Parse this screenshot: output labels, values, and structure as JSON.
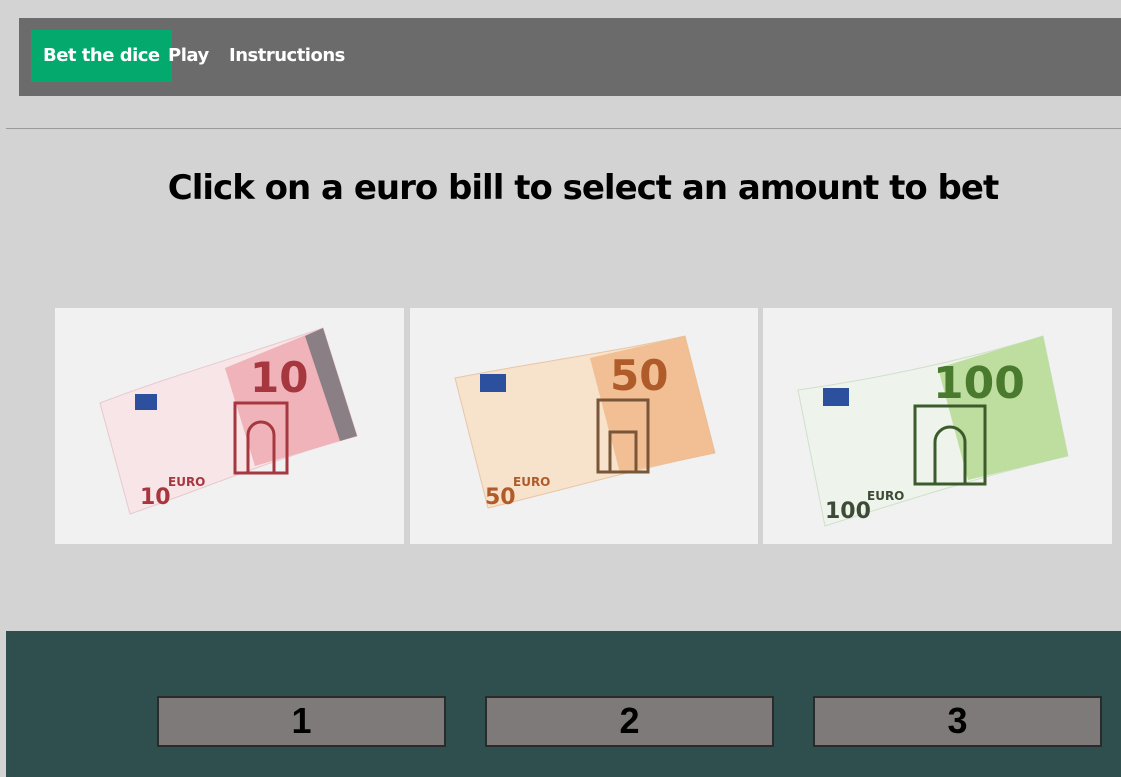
{
  "nav": {
    "items": [
      {
        "label": "Bet the dice",
        "active": true
      },
      {
        "label": "Play",
        "active": false
      },
      {
        "label": "Instructions",
        "active": false
      }
    ],
    "active_color": "#04aa6d",
    "bar_color": "#6b6b6b"
  },
  "main": {
    "heading": "Click on a euro bill to select an amount to bet",
    "bills": [
      {
        "value": "10",
        "currency": "EURO",
        "color": "#e9a0a6"
      },
      {
        "value": "50",
        "currency": "EURO",
        "color": "#f0b07a"
      },
      {
        "value": "100",
        "currency": "EURO",
        "color": "#8fcf6a"
      }
    ]
  },
  "footer": {
    "background": "#2f4f4f",
    "buttons": [
      {
        "label": "1"
      },
      {
        "label": "2"
      },
      {
        "label": "3"
      }
    ]
  }
}
